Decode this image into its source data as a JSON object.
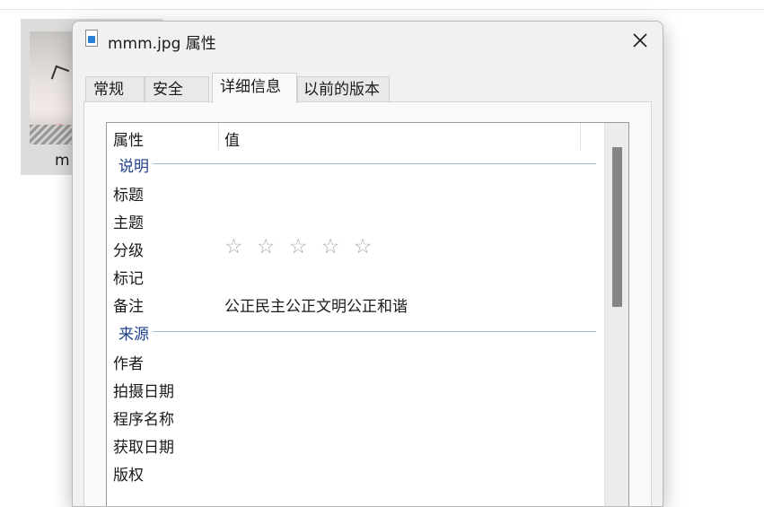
{
  "explorer": {
    "file_name_partial": "m"
  },
  "dialog": {
    "title": "mmm.jpg 属性",
    "close_icon": "close-icon",
    "tabs": [
      {
        "label": "常规",
        "active": false
      },
      {
        "label": "安全",
        "active": false
      },
      {
        "label": "详细信息",
        "active": true
      },
      {
        "label": "以前的版本",
        "active": false
      }
    ],
    "columns": {
      "property": "属性",
      "value": "值"
    },
    "groups": {
      "description": {
        "label": "说明",
        "rows": [
          {
            "key": "标题",
            "value": ""
          },
          {
            "key": "主题",
            "value": ""
          },
          {
            "key": "分级",
            "value": "☆ ☆ ☆ ☆ ☆",
            "rating": 0,
            "max": 5
          },
          {
            "key": "标记",
            "value": ""
          },
          {
            "key": "备注",
            "value": "公正民主公正文明公正和谐"
          }
        ]
      },
      "origin": {
        "label": "来源",
        "rows": [
          {
            "key": "作者",
            "value": ""
          },
          {
            "key": "拍摄日期",
            "value": ""
          },
          {
            "key": "程序名称",
            "value": ""
          },
          {
            "key": "获取日期",
            "value": ""
          },
          {
            "key": "版权",
            "value": ""
          }
        ]
      }
    },
    "colors": {
      "group_label": "#1e3f8a",
      "group_line": "#a7bcd8",
      "star": "#a9a9a9",
      "scroll_thumb": "#858585"
    }
  }
}
